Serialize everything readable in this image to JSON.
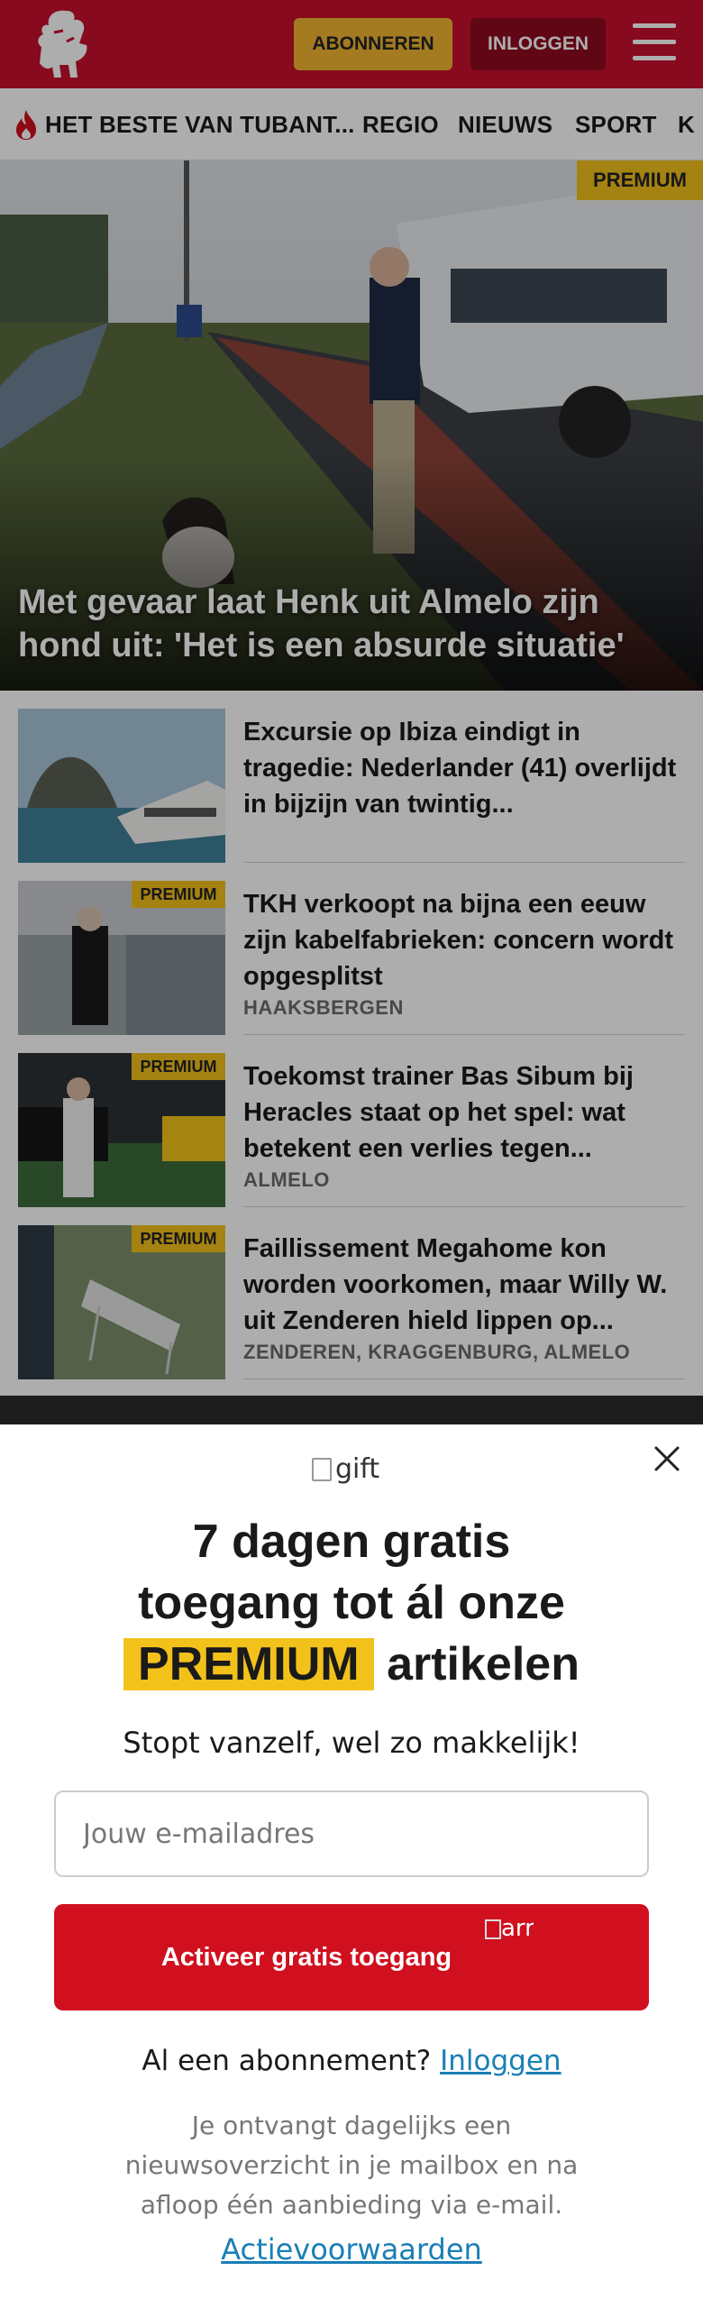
{
  "header": {
    "subscribe_label": "ABONNEREN",
    "login_label": "INLOGGEN",
    "brand_color": "#c8102e"
  },
  "nav": {
    "items": [
      "HET BESTE VAN TUBANT...",
      "REGIO",
      "NIEUWS",
      "SPORT",
      "K"
    ]
  },
  "hero": {
    "badge": "PREMIUM",
    "title": "Met gevaar laat Henk uit Almelo zijn hond uit: 'Het is een absurde situatie'"
  },
  "articles": [
    {
      "title": "Excursie op Ibiza eindigt in tragedie: Nederlander (41) overlijdt in bijzijn van twintig...",
      "location": "",
      "premium": false
    },
    {
      "title": "TKH verkoopt na bijna een eeuw zijn kabelfabrieken: concern wordt opgesplitst",
      "location": "HAAKSBERGEN",
      "premium": true,
      "badge": "PREMIUM"
    },
    {
      "title": "Toekomst trainer Bas Sibum bij Heracles staat op het spel: wat betekent een verlies tegen...",
      "location": "ALMELO",
      "premium": true,
      "badge": "PREMIUM"
    },
    {
      "title": "Faillissement Megahome kon worden voorkomen, maar Willy W. uit Zenderen hield lippen op...",
      "location": "ZENDEREN, KRAGGENBURG, ALMELO",
      "premium": true,
      "badge": "PREMIUM"
    }
  ],
  "modal": {
    "gift_alt": "gift",
    "title_line1": "7 dagen gratis",
    "title_line2": "toegang tot ál onze",
    "title_highlight": "PREMIUM",
    "title_line3_rest": "artikelen",
    "subtitle": "Stopt vanzelf, wel zo makkelijk!",
    "email_placeholder": "Jouw e-mailadres",
    "activate_label": "Activeer gratis toegang",
    "arrow_alt": "arrow-right",
    "has_subscription": "Al een abonnement?",
    "login_link": "Inloggen",
    "info": "Je ontvangt dagelijks een nieuwsoverzicht in je mailbox en na afloop één aanbieding via e-mail.",
    "terms_link": "Actievoorwaarden",
    "accent_color": "#d0101e",
    "highlight_color": "#f2c21b"
  }
}
